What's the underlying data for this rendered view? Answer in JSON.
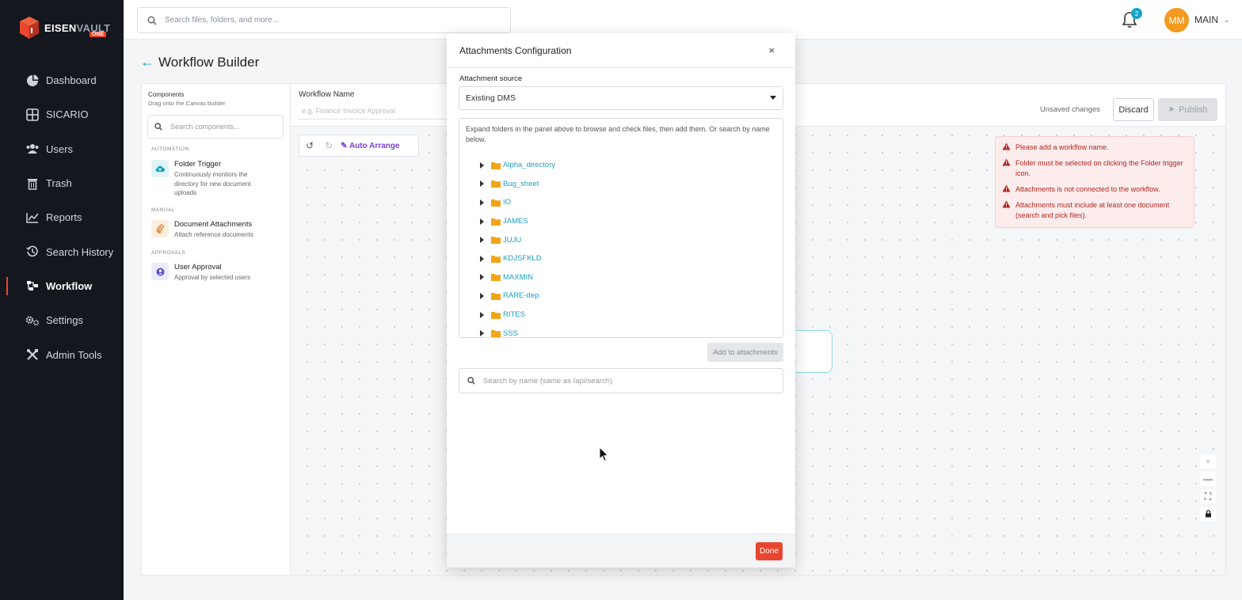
{
  "app": {
    "logo_name": "EISEN",
    "logo_accent": "VAULT",
    "logo_badge": "ONE",
    "brand_color": "#e8462e",
    "accent_color": "#1aa3c7"
  },
  "sidebar": {
    "items": [
      {
        "label": "Dashboard",
        "icon": "pie-chart-icon"
      },
      {
        "label": "SICARIO",
        "icon": "grid-icon"
      },
      {
        "label": "Users",
        "icon": "users-icon"
      },
      {
        "label": "Trash",
        "icon": "trash-icon"
      },
      {
        "label": "Reports",
        "icon": "line-chart-icon"
      },
      {
        "label": "Search History",
        "icon": "history-icon"
      },
      {
        "label": "Workflow",
        "icon": "workflow-icon",
        "active": true
      },
      {
        "label": "Settings",
        "icon": "gears-icon"
      },
      {
        "label": "Admin Tools",
        "icon": "tools-icon"
      }
    ]
  },
  "topbar": {
    "search_placeholder": "Search files, folders, and more...",
    "notification_count": "2",
    "avatar_initials": "MM",
    "user_name": "MAIN"
  },
  "page": {
    "title": "Workflow Builder"
  },
  "components": {
    "title": "Components",
    "subtitle": "Drag onto the Canvas builder",
    "search_placeholder": "Search components...",
    "sections": [
      {
        "label": "AUTOMATION",
        "items": [
          {
            "name": "Folder Trigger",
            "description": "Continuously monitors the directory for new document uploads",
            "icon": "cloud-upload-icon"
          }
        ]
      },
      {
        "label": "MANUAL",
        "items": [
          {
            "name": "Document Attachments",
            "description": "Attach reference documents",
            "icon": "paperclip-icon"
          }
        ]
      },
      {
        "label": "APPROVALS",
        "items": [
          {
            "name": "User Approval",
            "description": "Approval by selected users",
            "icon": "user-circle-icon"
          }
        ]
      }
    ]
  },
  "workflow": {
    "name_label": "Workflow Name",
    "name_placeholder": "e.g. Finance Invoice Approval",
    "unsaved": "Unsaved changes",
    "discard": "Discard",
    "publish": "Publish",
    "auto_arrange": "Auto Arrange"
  },
  "errors": [
    "Please add a workflow name.",
    "Folder must be selected on clicking the Folder trigger icon.",
    "Attachments is not connected to the workflow.",
    "Attachments must include at least one document (search and pick files)."
  ],
  "modal": {
    "title": "Attachments Configuration",
    "source_label": "Attachment source",
    "source_value": "Existing DMS",
    "hint": "Expand folders in the panel above to browse and check files, then add them. Or search by name below.",
    "folders": [
      "Alpha_directory",
      "Bug_sheet",
      "IO",
      "JAMES",
      "JUJU",
      "KDJSFKLD",
      "MAXMIN",
      "RARE-dep",
      "RITES",
      "SSS"
    ],
    "add_button": "Add to attachments",
    "search_placeholder": "Search by name (same as /api/search)",
    "done": "Done"
  }
}
